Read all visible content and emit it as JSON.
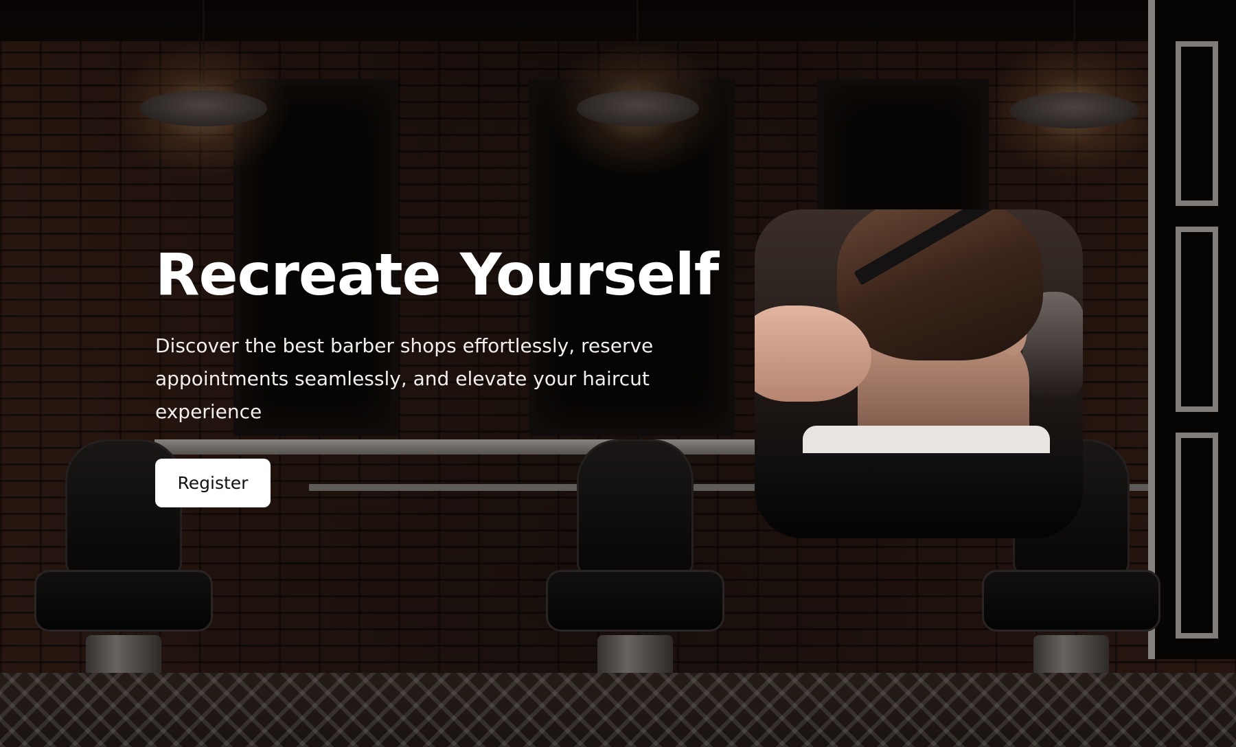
{
  "hero": {
    "title": "Recreate Yourself",
    "subtitle": "Discover the best barber shops effortlessly, reserve appointments seamlessly, and elevate your haircut experience",
    "register_label": "Register"
  },
  "images": {
    "background": "barbershop-interior-photo",
    "feature": "haircut-comb-photo"
  },
  "colors": {
    "title_text": "#ffffff",
    "subtitle_text": "#f2efec",
    "button_bg": "#ffffff",
    "button_text": "#111111"
  }
}
